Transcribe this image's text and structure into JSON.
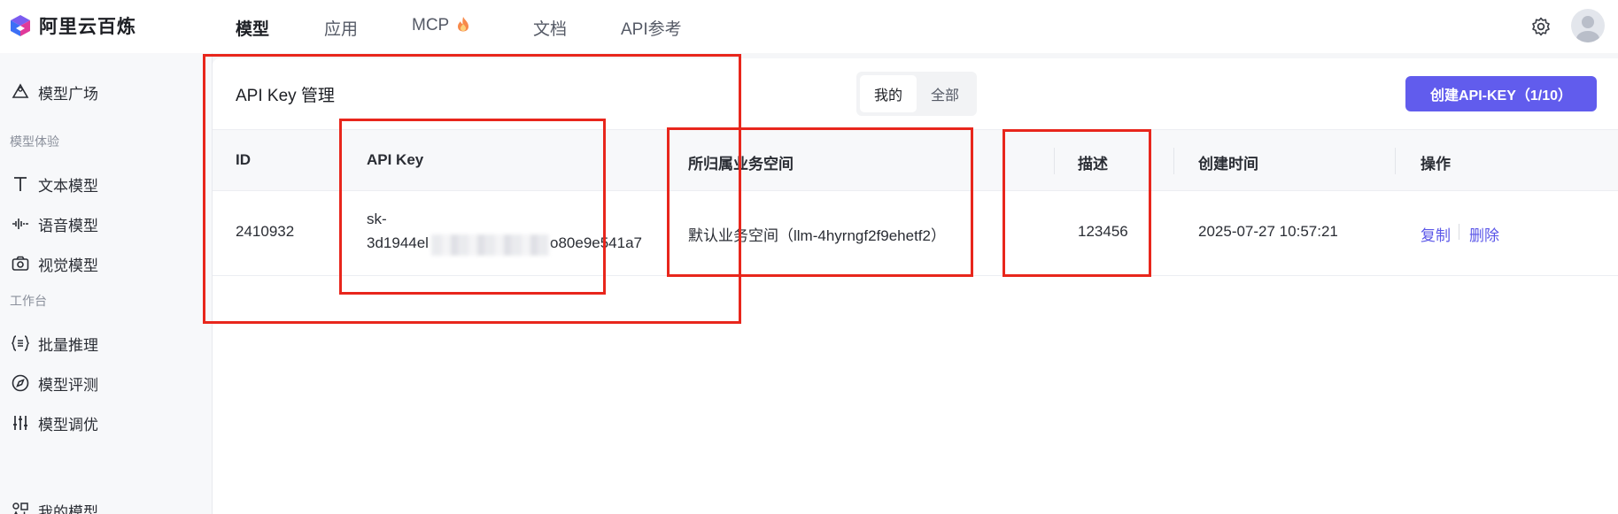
{
  "app": {
    "brand": "阿里云百炼"
  },
  "nav": {
    "items": [
      {
        "label": "模型",
        "active": true
      },
      {
        "label": "应用"
      },
      {
        "label": "MCP"
      },
      {
        "label": "文档"
      },
      {
        "label": "API参考"
      }
    ]
  },
  "sidebar": {
    "top_item": "模型广场",
    "group1_title": "模型体验",
    "group1_items": [
      "文本模型",
      "语音模型",
      "视觉模型"
    ],
    "group2_title": "工作台",
    "group2_items": [
      "批量推理",
      "模型评测",
      "模型调优",
      "我的模型"
    ]
  },
  "card": {
    "title": "API Key 管理",
    "tabs": [
      "我的",
      "全部"
    ],
    "active_tab": "我的",
    "create_button": "创建API-KEY（1/10）"
  },
  "table": {
    "columns": [
      "ID",
      "API Key",
      "所归属业务空间",
      "描述",
      "创建时间",
      "操作"
    ],
    "rows": [
      {
        "id": "2410932",
        "api_key_line1": "sk-",
        "api_key_line2_start": "3d1944el",
        "api_key_line2_end": "o80e9e541a7",
        "workspace": "默认业务空间（llm-4hyrngf2f9ehetf2）",
        "description": "123456",
        "created": "2025-07-27 10:57:21",
        "action_copy": "复制",
        "action_delete": "删除"
      }
    ]
  },
  "colors": {
    "accent": "#615ced",
    "link": "#5b57e8",
    "annotation": "#e8261c"
  }
}
